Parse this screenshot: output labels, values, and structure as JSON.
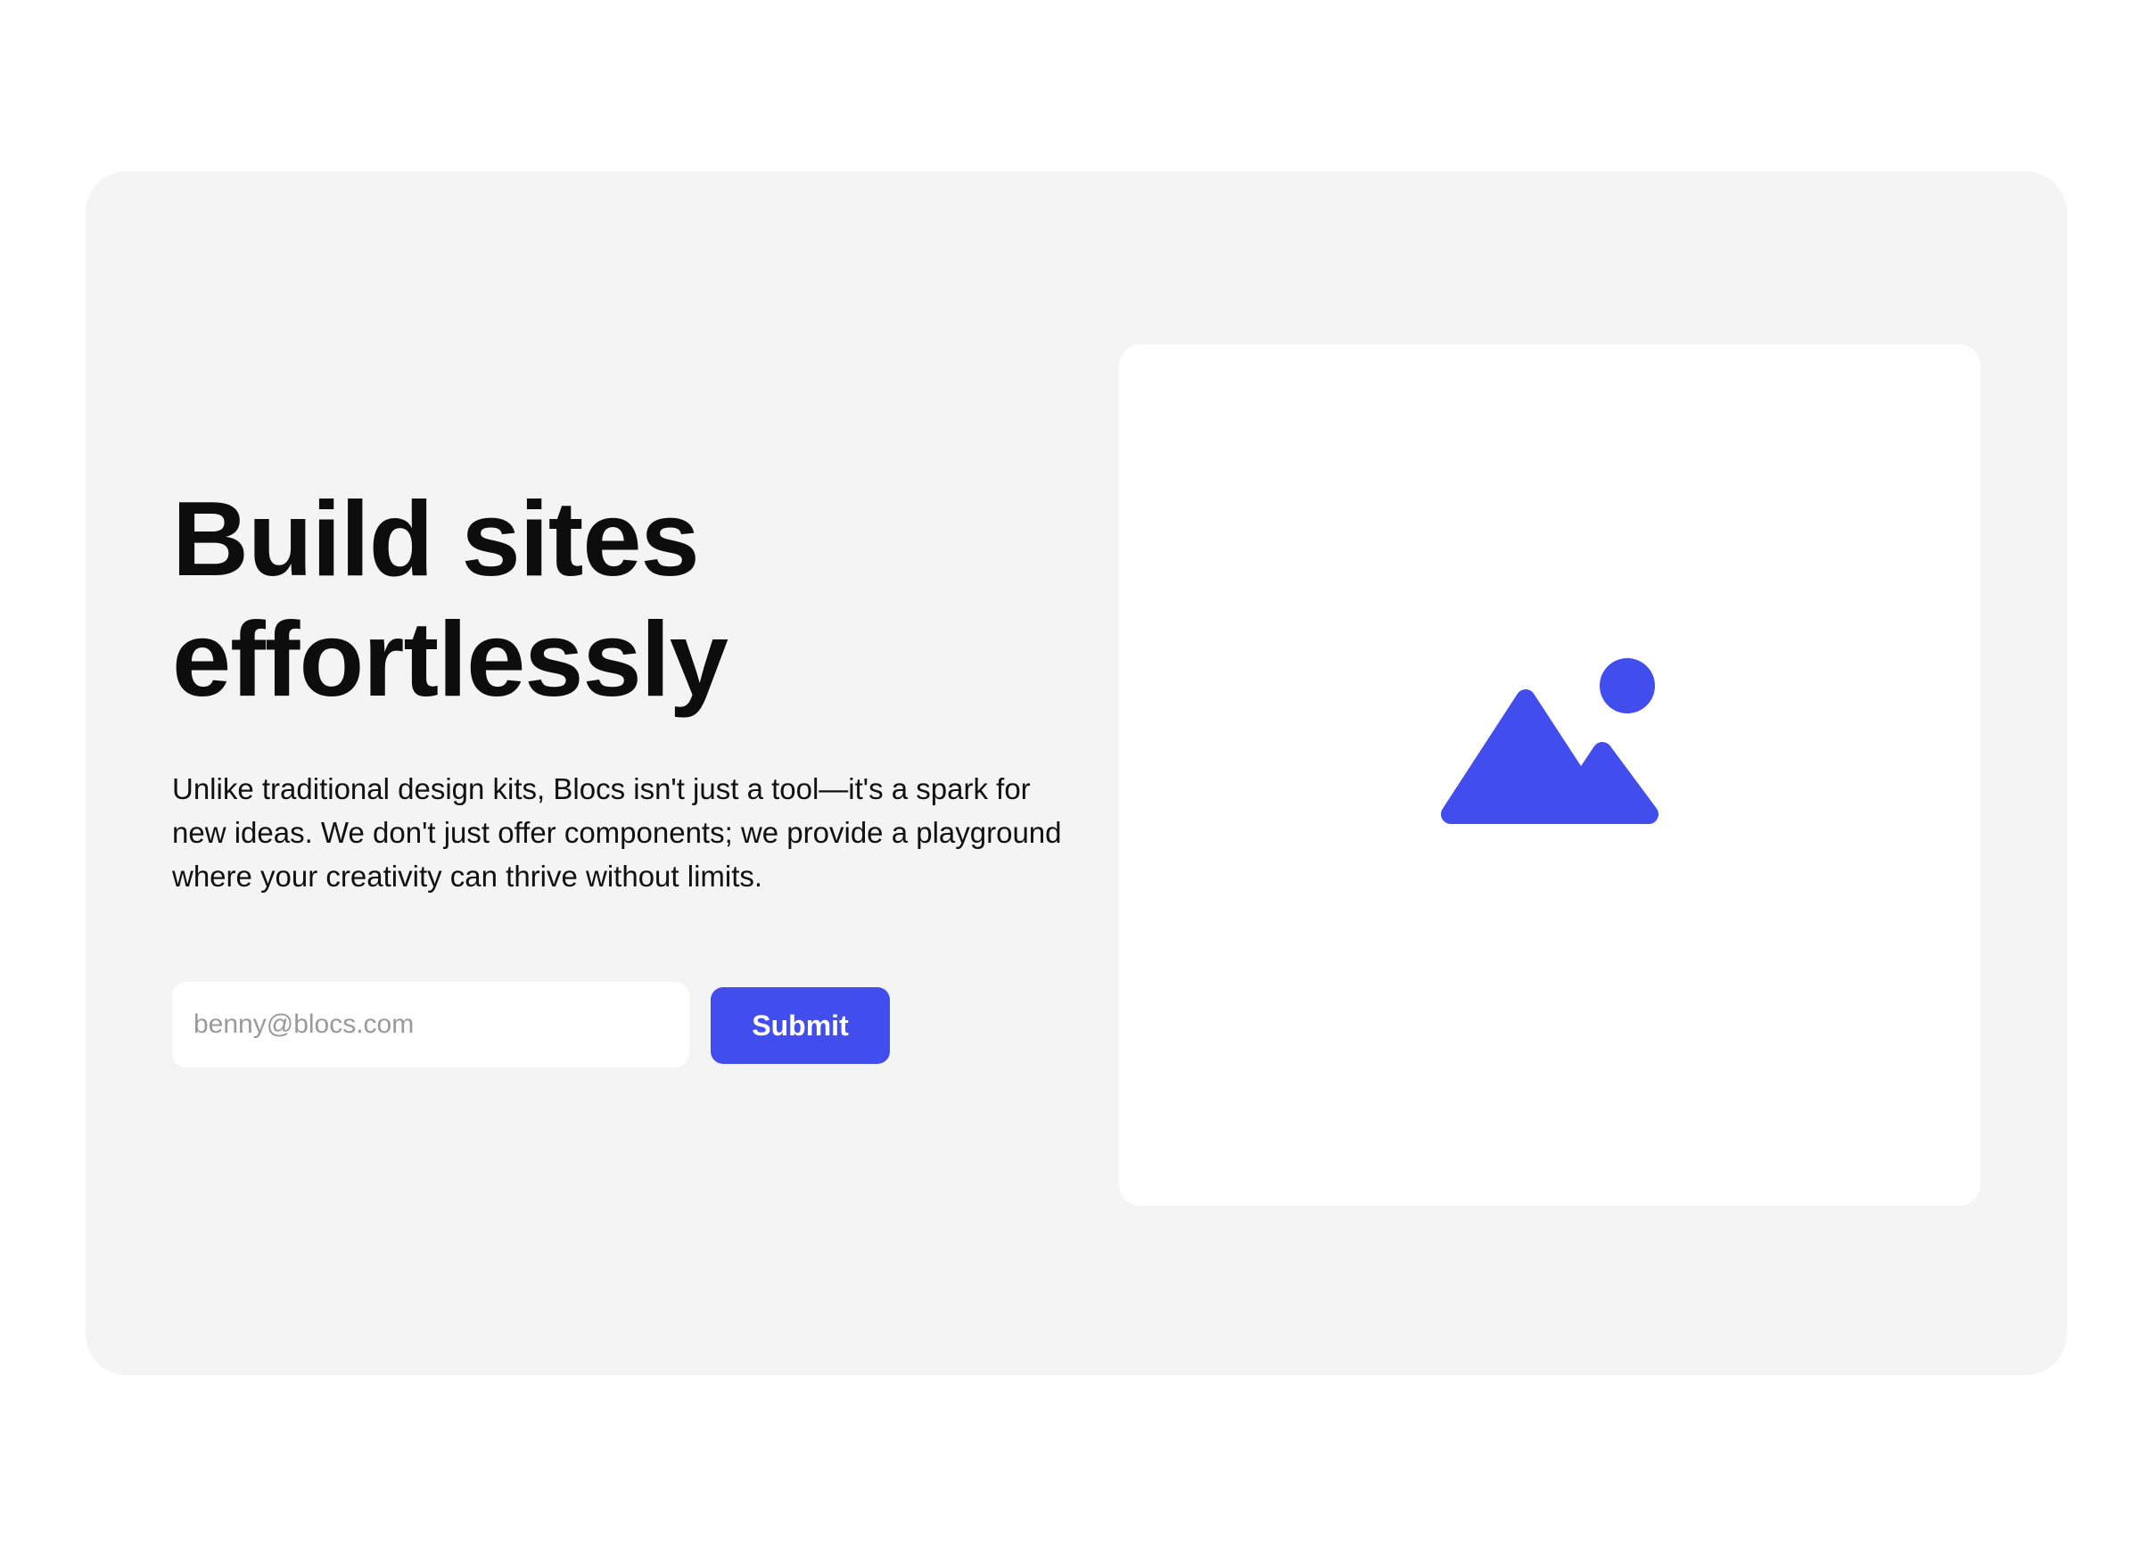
{
  "hero": {
    "headline": "Build sites effortlessly",
    "description": "Unlike traditional design kits, Blocs isn't just a tool—it's a spark for new ideas. We don't just offer components; we provide a playground where your creativity can thrive without limits.",
    "email_placeholder": "benny@blocs.com",
    "submit_label": "Submit"
  },
  "image_panel": {
    "icon": "image-icon"
  },
  "colors": {
    "accent": "#424ded",
    "card_background": "#f4f4f4",
    "panel_background": "#ffffff",
    "text": "#0d0d0d"
  }
}
